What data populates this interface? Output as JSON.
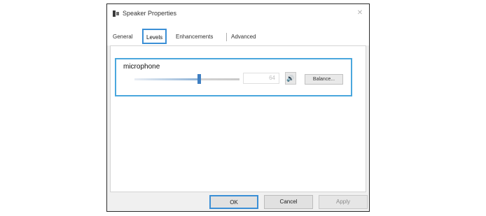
{
  "window": {
    "title": "Speaker Properties",
    "close_symbol": "✕",
    "app_icon": "speaker-icon"
  },
  "tabs": [
    {
      "label": "General"
    },
    {
      "label": "Levels"
    },
    {
      "label": "Enhancements"
    },
    {
      "label": "Advanced"
    }
  ],
  "active_tab": "Levels",
  "levels": {
    "label": "microphone",
    "value_display": "64",
    "slider_level_fraction": 0.61,
    "mute_icon": "speaker-volume-icon",
    "mute_symbol": "🔊",
    "balance_label": "Balance..."
  },
  "footer": {
    "ok_label": "OK",
    "cancel_label": "Cancel",
    "apply_label": "Apply"
  },
  "colors": {
    "accent": "#3b8fd6",
    "group_border": "#4aa7dd",
    "slider_thumb": "#3f7fc2"
  }
}
